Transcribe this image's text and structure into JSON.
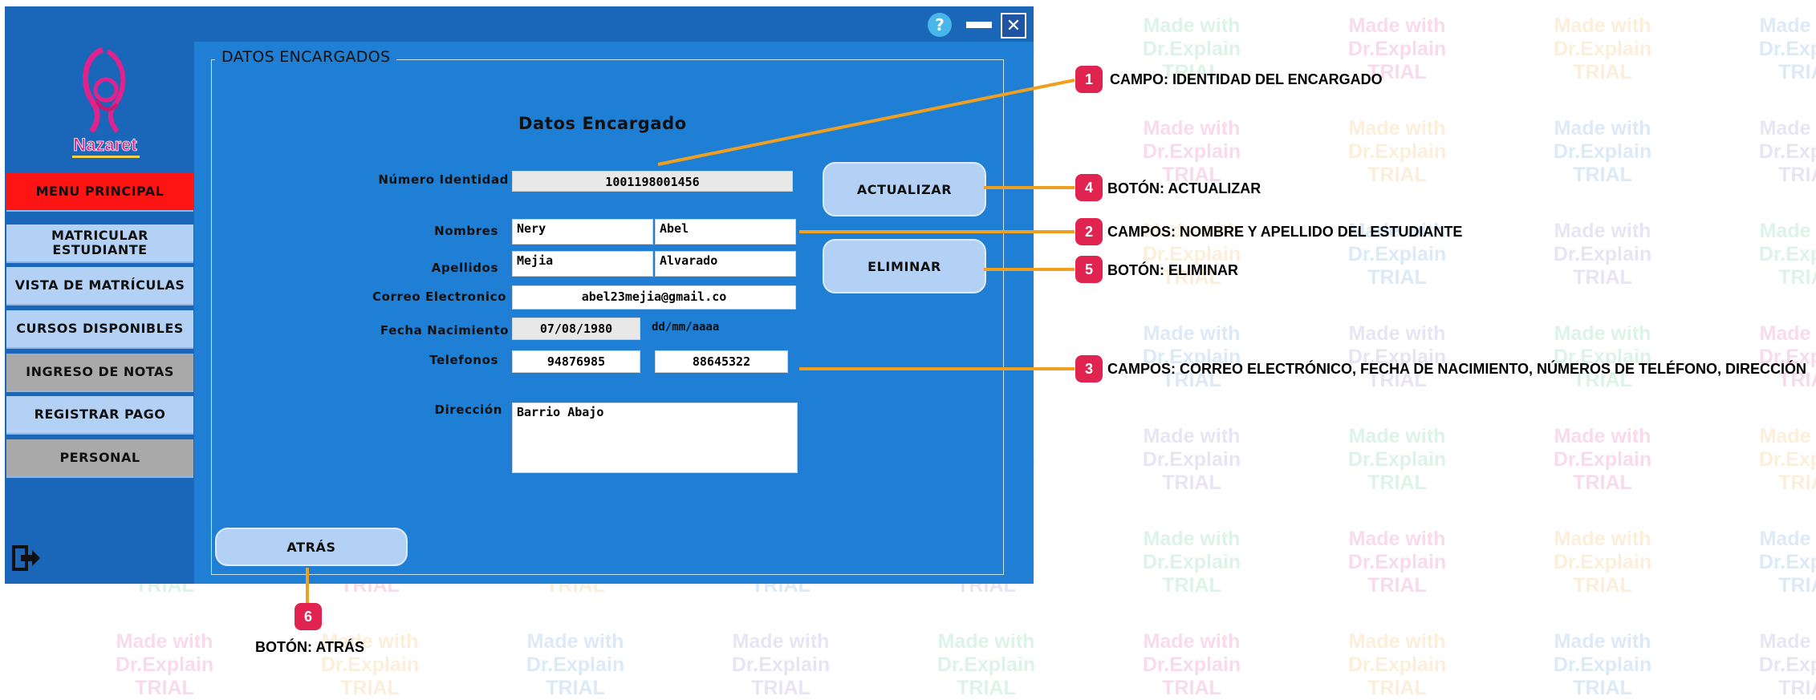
{
  "watermark": {
    "lines": [
      "Made with",
      "Dr.Explain",
      "TRIAL"
    ]
  },
  "app": {
    "logo_text": "Nazaret",
    "help_glyph": "?",
    "close_glyph": "✕",
    "sidebar": {
      "menu_principal": "MENU PRINCIPAL",
      "items": [
        {
          "label": "MATRICULAR ESTUDIANTE",
          "style": "light"
        },
        {
          "label": "VISTA DE MATRÍCULAS",
          "style": "light"
        },
        {
          "label": "CURSOS DISPONIBLES",
          "style": "light"
        },
        {
          "label": "INGRESO DE NOTAS",
          "style": "gray"
        },
        {
          "label": "REGISTRAR PAGO",
          "style": "light"
        },
        {
          "label": "PERSONAL",
          "style": "gray"
        }
      ]
    },
    "panel_title": "DATOS ENCARGADOS",
    "form": {
      "title": "Datos Encargado",
      "labels": {
        "identidad": "Número Identidad",
        "nombres": "Nombres",
        "apellidos": "Apellidos",
        "correo": "Correo Electronico",
        "fecha": "Fecha Nacimiento",
        "telefonos": "Telefonos",
        "direccion": "Dirección"
      },
      "values": {
        "identidad": "1001198001456",
        "nombre1": "Nery",
        "nombre2": "Abel",
        "apellido1": "Mejia",
        "apellido2": "Alvarado",
        "correo": "abel23mejia@gmail.co",
        "fecha": "07/08/1980",
        "fecha_hint": "dd/mm/aaaa",
        "telefono1": "94876985",
        "telefono2": "88645322",
        "direccion": "Barrio Abajo"
      },
      "buttons": {
        "actualizar": "ACTUALIZAR",
        "eliminar": "ELIMINAR",
        "atras": "ATRÁS"
      }
    }
  },
  "callouts": [
    {
      "number": "1",
      "text": "CAMPO: IDENTIDAD DEL ENCARGADO"
    },
    {
      "number": "4",
      "text": "BOTÓN: ACTUALIZAR"
    },
    {
      "number": "2",
      "text": "CAMPOS: NOMBRE Y APELLIDO DEL ESTUDIANTE"
    },
    {
      "number": "5",
      "text": "BOTÓN: ELIMINAR"
    },
    {
      "number": "3",
      "text": "CAMPOS: CORREO ELECTRÓNICO, FECHA DE NACIMIENTO, NÚMEROS DE TELÉFONO, DIRECCIÓN"
    },
    {
      "number": "6",
      "text": "BOTÓN: ATRÁS"
    }
  ],
  "colors": {
    "app_blue": "#1f7fd4",
    "sidebar_blue": "#1a66b8",
    "menu_red": "#ff1414",
    "nav_light": "#b3d0f5",
    "nav_gray": "#a9a9a9",
    "callout_line": "#f0a020",
    "badge": "#e0234f"
  }
}
